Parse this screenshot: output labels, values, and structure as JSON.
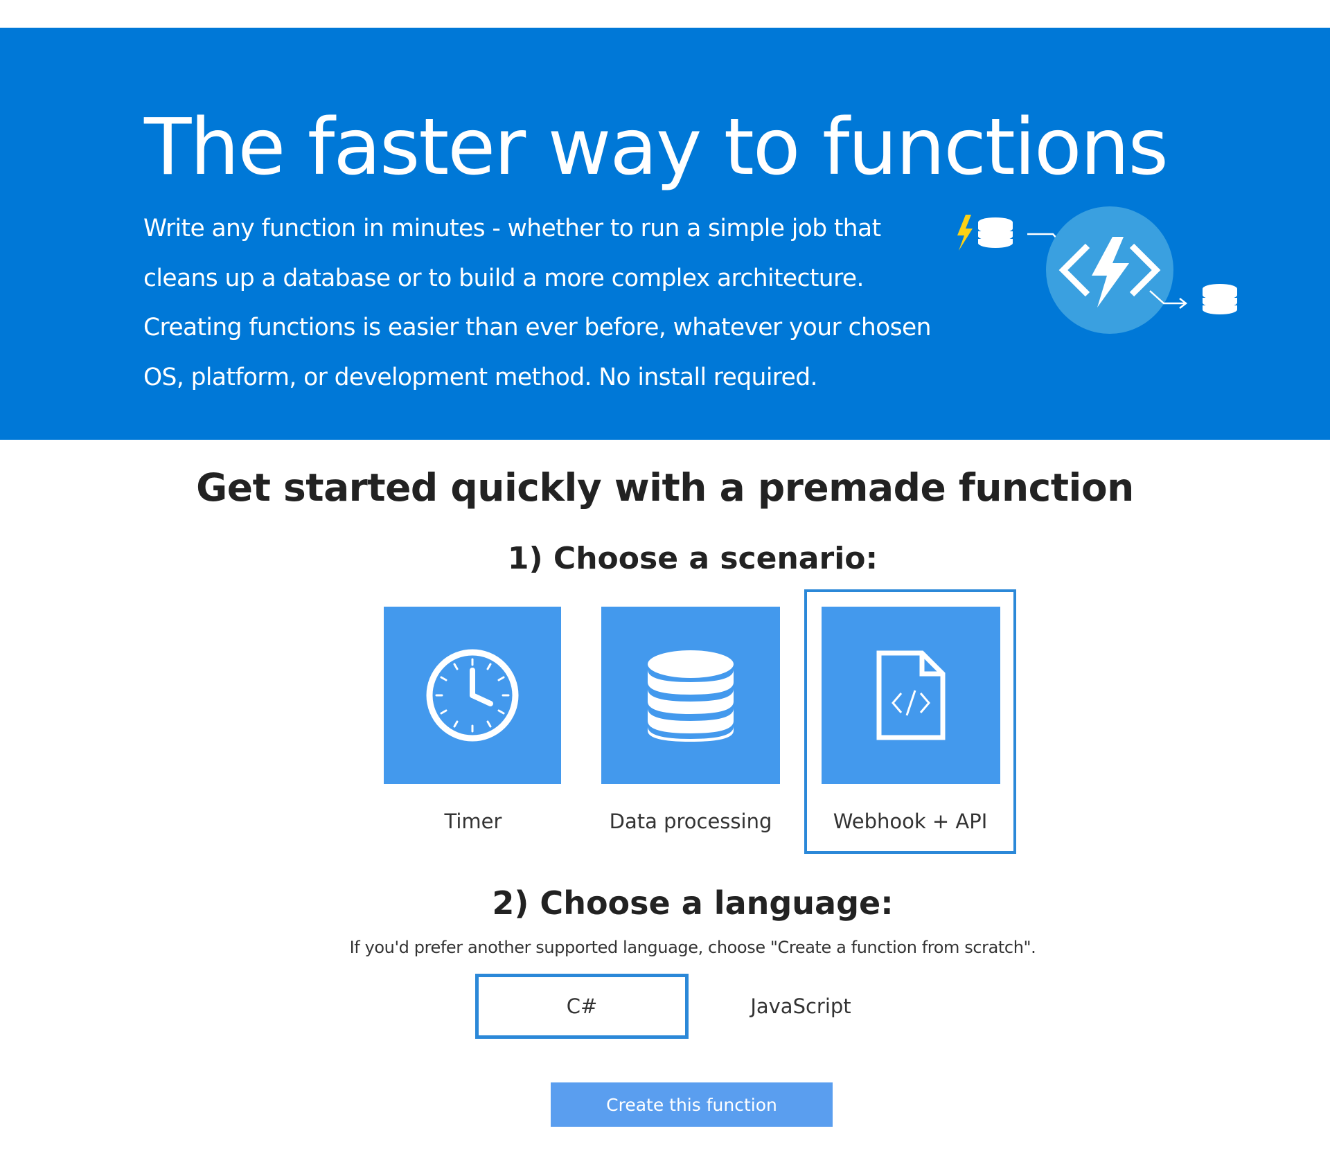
{
  "hero": {
    "title": "The faster way to functions",
    "description": "Write any function in minutes - whether to run a simple job that cleans up a database or to build a more complex architecture. Creating functions is easier than ever before, whatever your chosen OS, platform, or development method. No install required.",
    "bg_color": "#0078d7"
  },
  "quickstart": {
    "title": "Get started quickly with a premade function",
    "step1_heading": "1) Choose a scenario:",
    "scenarios": [
      {
        "label": "Timer",
        "icon": "clock-icon",
        "selected": false
      },
      {
        "label": "Data processing",
        "icon": "database-icon",
        "selected": false
      },
      {
        "label": "Webhook + API",
        "icon": "code-file-icon",
        "selected": true
      }
    ],
    "step2_heading": "2) Choose a language:",
    "step2_note": "If you'd prefer another supported language, choose \"Create a function from scratch\".",
    "languages": [
      {
        "label": "C#",
        "selected": true
      },
      {
        "label": "JavaScript",
        "selected": false
      }
    ],
    "create_button": "Create this function"
  },
  "colors": {
    "tile": "#4399ed",
    "selection_border": "#2b88d8",
    "button": "#5a9eef"
  }
}
